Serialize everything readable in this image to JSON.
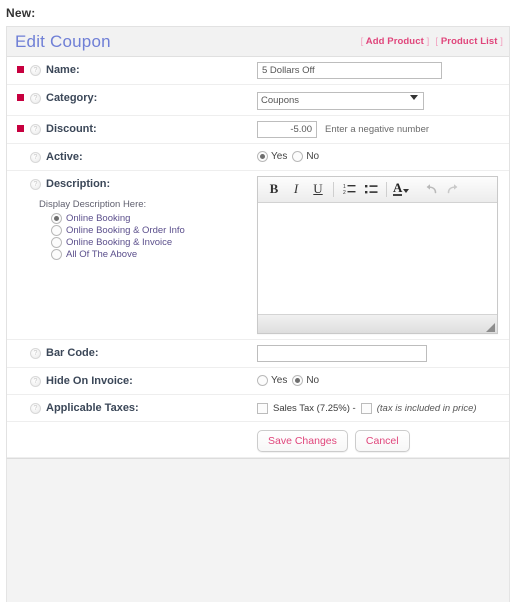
{
  "page": {
    "new_label": "New:"
  },
  "header": {
    "title": "Edit Coupon",
    "links": [
      {
        "label": "Add Product",
        "open": "[",
        "close": "]"
      },
      {
        "label": "Product List",
        "open": "[",
        "close": "]"
      }
    ],
    "title_color": "#6f7fd6",
    "link_color": "#e0457b"
  },
  "form": {
    "required_marker_color": "#c7003f",
    "help_icon": "question-circle-icon",
    "rows": {
      "name": {
        "label": "Name:",
        "value": "5 Dollars Off",
        "required": true
      },
      "category": {
        "label": "Category:",
        "value": "Coupons",
        "required": true,
        "options": [
          "Coupons"
        ]
      },
      "discount": {
        "label": "Discount:",
        "value": "-5.00",
        "required": true,
        "hint": "Enter a negative number"
      },
      "active": {
        "label": "Active:",
        "options": [
          "Yes",
          "No"
        ],
        "selected": "Yes"
      },
      "description": {
        "label": "Description:",
        "sub_title": "Display Description Here:",
        "options": [
          "Online Booking",
          "Online Booking & Order Info",
          "Online Booking & Invoice",
          "All Of The Above"
        ],
        "selected": "Online Booking",
        "editor_content": ""
      },
      "barcode": {
        "label": "Bar Code:",
        "value": ""
      },
      "hide_on_invoice": {
        "label": "Hide On Invoice:",
        "options": [
          "Yes",
          "No"
        ],
        "selected": "No"
      },
      "taxes": {
        "label": "Applicable Taxes:",
        "tax_name": "Sales Tax (7.25%) -",
        "tax_checked": false,
        "included_note": "(tax is included in price)",
        "included_checked": false
      }
    }
  },
  "editor_toolbar": {
    "bold": "B",
    "italic": "I",
    "underline": "U",
    "ordered_list": "ordered-list-icon",
    "bullet_list": "bullet-list-icon",
    "text_color_letter": "A",
    "undo": "↰",
    "redo": "↱"
  },
  "actions": {
    "save": "Save Changes",
    "cancel": "Cancel"
  }
}
